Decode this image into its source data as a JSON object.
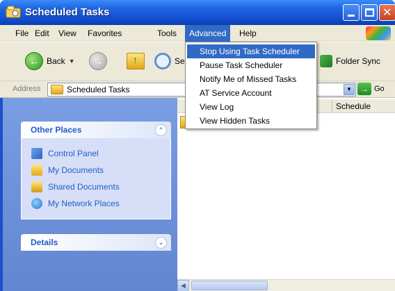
{
  "window": {
    "title": "Scheduled Tasks"
  },
  "menubar": {
    "items": [
      "File",
      "Edit",
      "View",
      "Favorites",
      "Tools",
      "Advanced",
      "Help"
    ]
  },
  "toolbar": {
    "back_label": "Back",
    "search_label": "Se",
    "folder_sync_label": "Folder Sync"
  },
  "address": {
    "label": "Address",
    "value": "Scheduled Tasks",
    "go_label": "Go"
  },
  "left_pane": {
    "other_places": {
      "title": "Other Places",
      "items": [
        "Control Panel",
        "My Documents",
        "Shared Documents",
        "My Network Places"
      ]
    },
    "details": {
      "title": "Details"
    }
  },
  "right_pane": {
    "column_header": "Schedule"
  },
  "advanced_menu": {
    "items": [
      "Stop Using Task Scheduler",
      "Pause Task Scheduler",
      "Notify Me of Missed Tasks",
      "AT Service Account",
      "View Log",
      "View Hidden Tasks"
    ]
  },
  "colors": {
    "titlebar": "#1654d6",
    "menu_highlight": "#316ac5",
    "task_pane_bg": "#6b8fd8",
    "panel_title": "#215dc6"
  }
}
